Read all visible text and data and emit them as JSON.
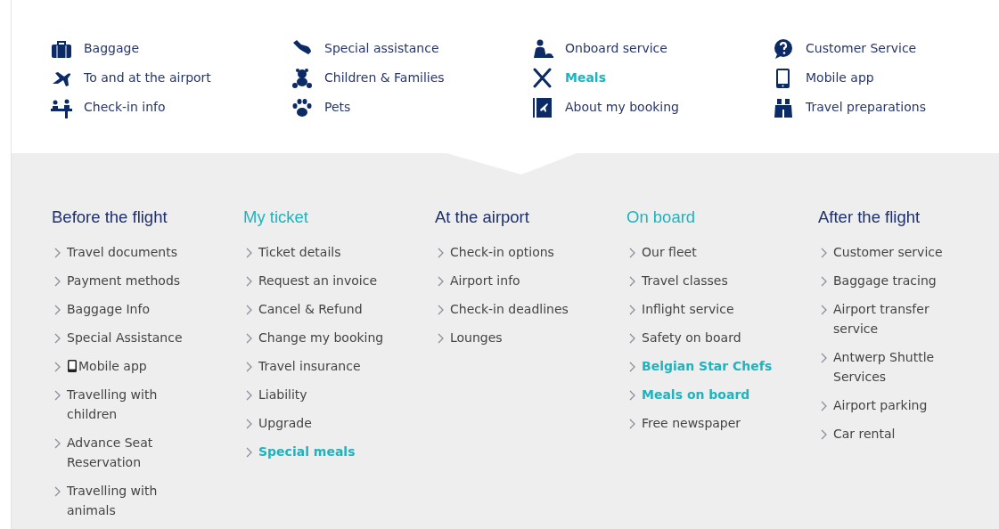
{
  "topics": [
    {
      "label": "Baggage",
      "active": false
    },
    {
      "label": "To and at the airport",
      "active": false
    },
    {
      "label": "Check-in info",
      "active": false
    },
    {
      "label": "Special assistance",
      "active": false
    },
    {
      "label": "Children & Families",
      "active": false
    },
    {
      "label": "Pets",
      "active": false
    },
    {
      "label": "Onboard service",
      "active": false
    },
    {
      "label": "Meals",
      "active": true
    },
    {
      "label": "About my booking",
      "active": false
    },
    {
      "label": "Customer Service",
      "active": false
    },
    {
      "label": "Mobile app",
      "active": false
    },
    {
      "label": "Travel preparations",
      "active": false
    }
  ],
  "columns": [
    {
      "heading": "Before the flight",
      "active": false,
      "links": [
        {
          "label": "Travel documents",
          "kind": "plain",
          "active": false
        },
        {
          "label": "Payment methods",
          "kind": "plain",
          "active": false
        },
        {
          "label": "Baggage Info",
          "kind": "plain",
          "active": false
        },
        {
          "label": "Special Assistance",
          "kind": "plain",
          "active": false
        },
        {
          "label": "Mobile app",
          "kind": "app",
          "active": false
        },
        {
          "label": "Travelling with children",
          "kind": "plain",
          "active": false
        },
        {
          "label": "Advance Seat Reservation",
          "kind": "plain",
          "active": false
        },
        {
          "label": "Travelling with animals",
          "kind": "plain",
          "active": false
        }
      ]
    },
    {
      "heading": "My ticket",
      "active": true,
      "links": [
        {
          "label": "Ticket details",
          "kind": "plain",
          "active": false
        },
        {
          "label": "Request an invoice",
          "kind": "plain",
          "active": false
        },
        {
          "label": "Cancel & Refund",
          "kind": "plain",
          "active": false
        },
        {
          "label": "Change my booking",
          "kind": "plain",
          "active": false
        },
        {
          "label": "Travel insurance",
          "kind": "plain",
          "active": false
        },
        {
          "label": "Liability",
          "kind": "plain",
          "active": false
        },
        {
          "label": "Upgrade",
          "kind": "plain",
          "active": false
        },
        {
          "label": "Special meals",
          "kind": "plain",
          "active": true
        }
      ]
    },
    {
      "heading": "At the airport",
      "active": false,
      "links": [
        {
          "label": "Check-in options",
          "kind": "plain",
          "active": false
        },
        {
          "label": "Airport info",
          "kind": "plain",
          "active": false
        },
        {
          "label": "Check-in deadlines",
          "kind": "plain",
          "active": false
        },
        {
          "label": "Lounges",
          "kind": "plain",
          "active": false
        }
      ]
    },
    {
      "heading": "On board",
      "active": true,
      "links": [
        {
          "label": "Our fleet",
          "kind": "plain",
          "active": false
        },
        {
          "label": "Travel classes",
          "kind": "plain",
          "active": false
        },
        {
          "label": "Inflight service",
          "kind": "plain",
          "active": false
        },
        {
          "label": "Safety on board",
          "kind": "plain",
          "active": false
        },
        {
          "label": "Belgian Star Chefs",
          "kind": "plain",
          "active": true
        },
        {
          "label": "Meals on board",
          "kind": "plain",
          "active": true
        },
        {
          "label": "Free newspaper",
          "kind": "plain",
          "active": false
        }
      ]
    },
    {
      "heading": "After the flight",
      "active": false,
      "links": [
        {
          "label": "Customer service",
          "kind": "plain",
          "active": false
        },
        {
          "label": "Baggage tracing",
          "kind": "plain",
          "active": false
        },
        {
          "label": "Airport transfer service",
          "kind": "plain",
          "active": false
        },
        {
          "label": "Antwerp Shuttle Services",
          "kind": "plain",
          "active": false
        },
        {
          "label": "Airport parking",
          "kind": "plain",
          "active": false
        },
        {
          "label": "Car rental",
          "kind": "plain",
          "active": false
        }
      ]
    }
  ]
}
